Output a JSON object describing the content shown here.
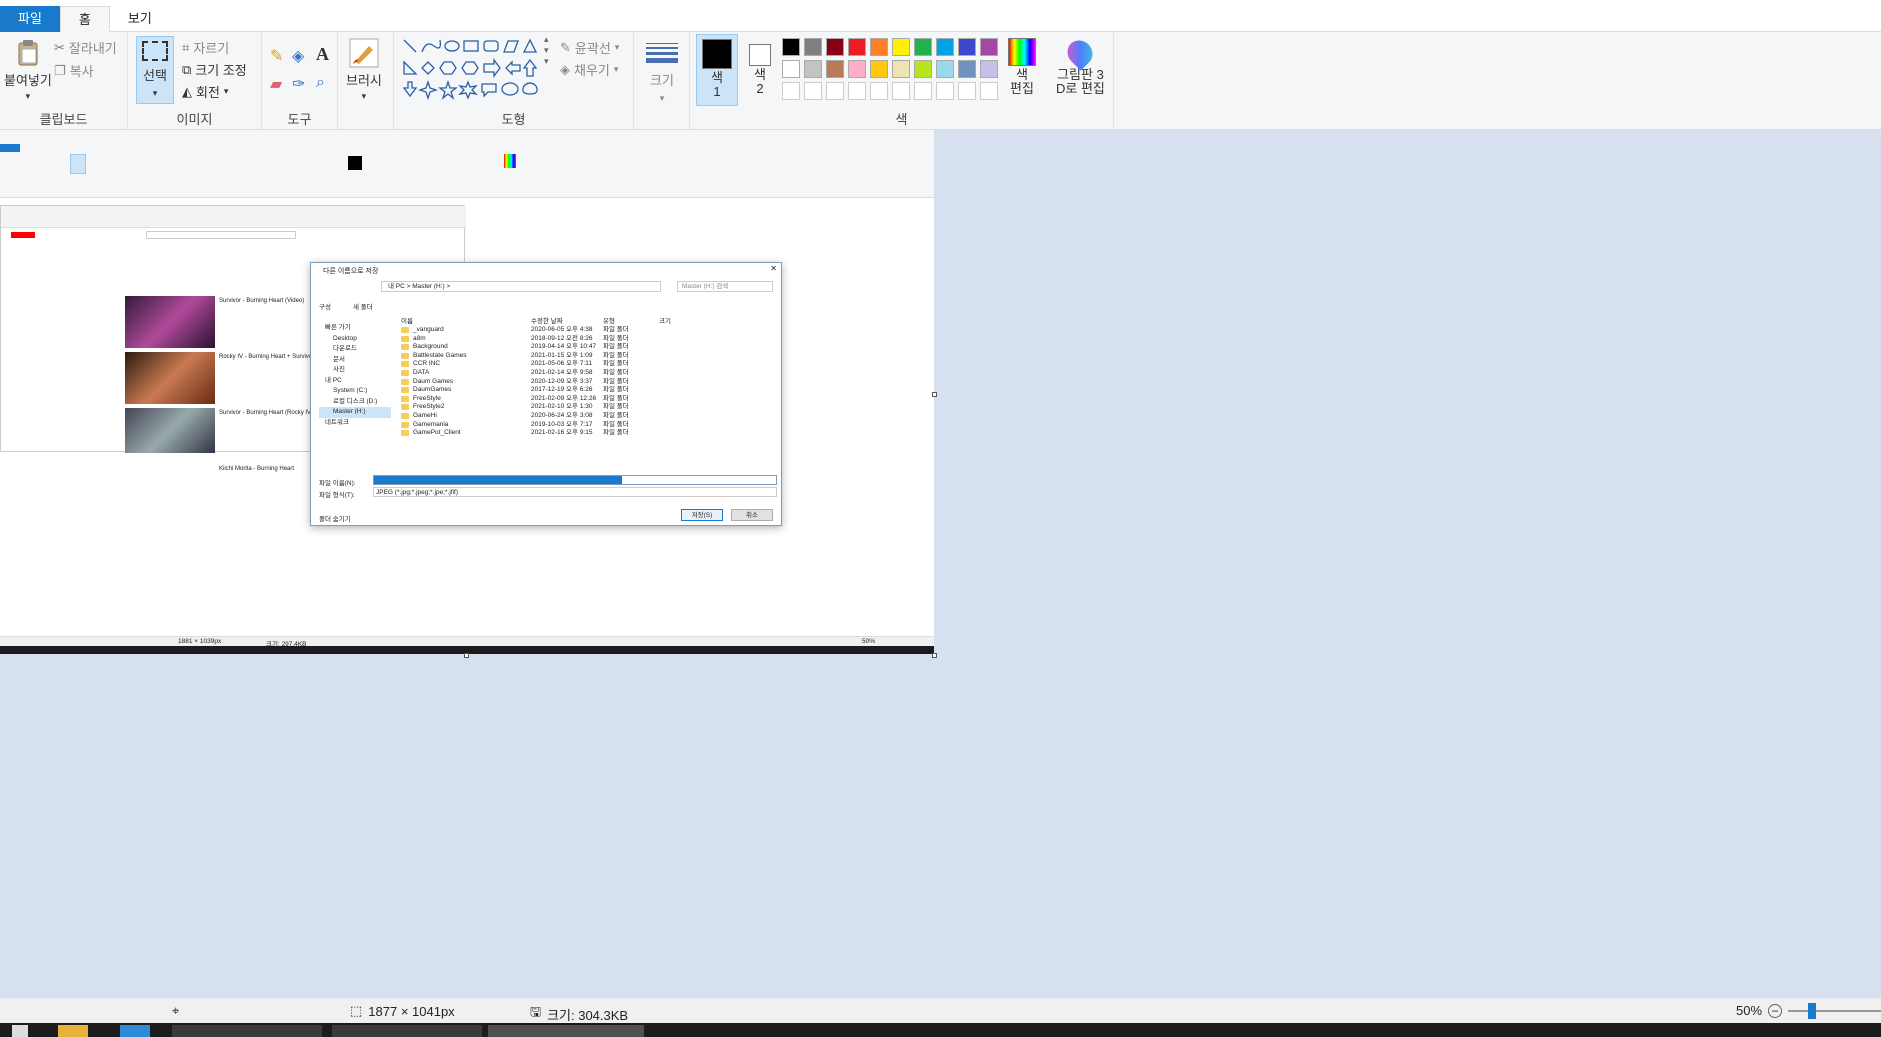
{
  "tabs": {
    "file": "파일",
    "home": "홈",
    "view": "보기"
  },
  "ribbon": {
    "clipboard": {
      "paste": "붙여넣기",
      "cut": "잘라내기",
      "copy": "복사",
      "label": "클립보드"
    },
    "image": {
      "select": "선택",
      "crop": "자르기",
      "resize": "크기 조정",
      "rotate": "회전",
      "label": "이미지"
    },
    "tools": {
      "label": "도구"
    },
    "brush": {
      "label": "브러시"
    },
    "shapes": {
      "outline": "윤곽선",
      "fill": "채우기",
      "label": "도형"
    },
    "size": {
      "label": "크기"
    },
    "colors": {
      "color1": "색\n1",
      "color2": "색\n2",
      "edit": "색\n편집",
      "label": "색",
      "paint3d": "그림판 3\nD로 편집",
      "row1": [
        "#000000",
        "#7f7f7f",
        "#880015",
        "#ed1c24",
        "#ff7f27",
        "#fff200",
        "#22b14c",
        "#00a2e8",
        "#3f48cc",
        "#a349a4"
      ],
      "row2": [
        "#ffffff",
        "#c3c3c3",
        "#b97a57",
        "#ffaec9",
        "#ffc90e",
        "#efe4b0",
        "#b5e61d",
        "#99d9ea",
        "#7092be",
        "#c8bfe7"
      ]
    }
  },
  "status": {
    "dimensions": "1877 × 1041px",
    "size": "크기: 304.3KB",
    "zoom": "50%"
  },
  "inner": {
    "dialog_title": "다른 이름으로 저장",
    "path": "내 PC  >  Master (H:)  >",
    "search": "Master (H:) 검색",
    "organize": "구성",
    "new_folder": "새 폴더",
    "columns": [
      "이름",
      "수정한 날짜",
      "유형",
      "크기"
    ],
    "nav": [
      "빠른 가기",
      "Desktop",
      "다운로드",
      "문서",
      "사진",
      "내 PC",
      "System (C:)",
      "로컬 디스크 (D:)",
      "Master (H:)",
      "네트워크"
    ],
    "files": [
      [
        "_vanguard",
        "2020-06-05 오후 4:38",
        "파일 폴더"
      ],
      [
        "a8m",
        "2018-09-12 오전 8:26",
        "파일 폴더"
      ],
      [
        "Background",
        "2019-04-14 오후 10:47",
        "파일 폴더"
      ],
      [
        "Battlestate Games",
        "2021-01-15 오후 1:09",
        "파일 폴더"
      ],
      [
        "CCR INC",
        "2021-05-06 오후 7:11",
        "파일 폴더"
      ],
      [
        "DATA",
        "2021-02-14 오후 9:58",
        "파일 폴더"
      ],
      [
        "Daum Games",
        "2020-12-09 오후 3:37",
        "파일 폴더"
      ],
      [
        "DaumGames",
        "2017-12-19 오후 6:26",
        "파일 폴더"
      ],
      [
        "FreeStyle",
        "2021-02-09 오후 12:26",
        "파일 폴더"
      ],
      [
        "FreeStyle2",
        "2021-02-10 오후 1:30",
        "파일 폴더"
      ],
      [
        "GameHi",
        "2020-06-24 오후 3:08",
        "파일 폴더"
      ],
      [
        "Gamemania",
        "2019-10-03 오후 7:17",
        "파일 폴더"
      ],
      [
        "GamePot_Client",
        "2021-02-16 오후 9:15",
        "파일 폴더"
      ]
    ],
    "filename_label": "파일 이름(N):",
    "filetype_label": "파일 형식(T):",
    "filetype": "JPEG (*.jpg;*.jpeg;*.jpe;*.jfif)",
    "save": "저장(S)",
    "cancel": "취소",
    "hide_folders": "폴더 숨기기",
    "inner_status_dim": "1881 × 1039px",
    "inner_status_size": "크기: 297.4KB",
    "inner_zoom": "50%",
    "video_titles": [
      "Survivor - Burning Heart (Video)",
      "Rocky IV - Burning Heart + Survivor",
      "Survivor - Burning Heart (Rocky IV)(HQ)",
      "Kiichi Morita - Burning Heart"
    ]
  }
}
